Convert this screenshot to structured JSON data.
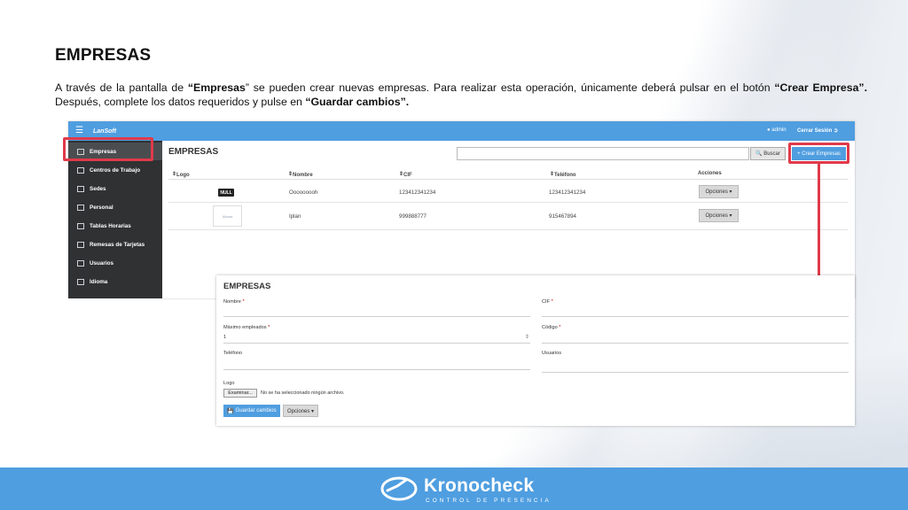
{
  "slide": {
    "title": "EMPRESAS",
    "paragraph_part1": "A través de la pantalla de ",
    "paragraph_bold1": "“Empresas",
    "paragraph_part2": "” se pueden crear nuevas empresas. Para realizar esta operación, únicamente deberá pulsar en el botón ",
    "paragraph_bold2": "“Crear Empresa”.",
    "paragraph_part3": " Después, complete los datos requeridos y pulse en ",
    "paragraph_bold3": "“Guardar cambios”."
  },
  "app": {
    "logo": "LanSoft",
    "user": "admin",
    "logout": "Cerrar Sesión",
    "sidebar": [
      {
        "label": "Empresas"
      },
      {
        "label": "Centros de Trabajo"
      },
      {
        "label": "Sedes"
      },
      {
        "label": "Personal"
      },
      {
        "label": "Tablas Horarias"
      },
      {
        "label": "Remesas de Tarjetas"
      },
      {
        "label": "Usuarios"
      },
      {
        "label": "Idioma"
      }
    ],
    "main_title": "EMPRESAS",
    "search_button": "Buscar",
    "create_button": "+ Crear Empresas",
    "columns": [
      "Logo",
      "Nombre",
      "CIF",
      "Teléfono",
      "Acciones"
    ],
    "rows": [
      {
        "logo": "NULL",
        "nombre": "Ooooooooh",
        "cif": "123412341234",
        "telefono": "123412341234",
        "acciones": "Opciones ▾"
      },
      {
        "logo": "Aitana",
        "nombre": "Iplan",
        "cif": "999888777",
        "telefono": "915467894",
        "acciones": "Opciones ▾"
      }
    ]
  },
  "form": {
    "title": "EMPRESAS",
    "nombre_label": "Nombre",
    "cif_label": "CIF",
    "max_empleados_label": "Máximo empleados",
    "max_empleados_value": "1",
    "codigo_label": "Código",
    "telefono_label": "Teléfono",
    "usuarios_label": "Usuarios",
    "logo_label": "Logo",
    "browse_button": "Examinar...",
    "file_status": "No se ha seleccionado ningún archivo.",
    "save_button": "Guardar cambios",
    "options_button": "Opciones ▾",
    "required_mark": "*"
  },
  "footer": {
    "brand": "Kronocheck",
    "subtitle": "CONTROL DE PRESENCIA"
  },
  "colors": {
    "accent": "#4f9ee0",
    "highlight": "#e03a4a",
    "sidebar": "#2f3133"
  }
}
